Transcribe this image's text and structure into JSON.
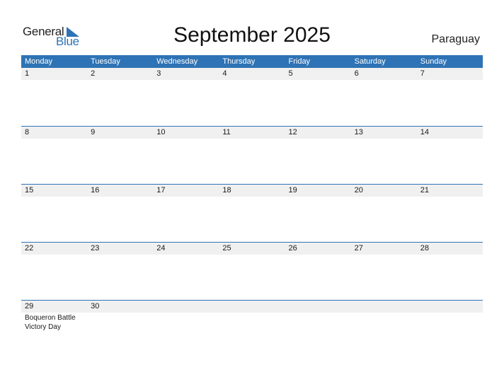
{
  "logo": {
    "word1": "General",
    "word2": "Blue"
  },
  "title": "September 2025",
  "country": "Paraguay",
  "weekdays": [
    "Monday",
    "Tuesday",
    "Wednesday",
    "Thursday",
    "Friday",
    "Saturday",
    "Sunday"
  ],
  "weeks": [
    {
      "days": [
        "1",
        "2",
        "3",
        "4",
        "5",
        "6",
        "7"
      ],
      "events": [
        "",
        "",
        "",
        "",
        "",
        "",
        ""
      ]
    },
    {
      "days": [
        "8",
        "9",
        "10",
        "11",
        "12",
        "13",
        "14"
      ],
      "events": [
        "",
        "",
        "",
        "",
        "",
        "",
        ""
      ]
    },
    {
      "days": [
        "15",
        "16",
        "17",
        "18",
        "19",
        "20",
        "21"
      ],
      "events": [
        "",
        "",
        "",
        "",
        "",
        "",
        ""
      ]
    },
    {
      "days": [
        "22",
        "23",
        "24",
        "25",
        "26",
        "27",
        "28"
      ],
      "events": [
        "",
        "",
        "",
        "",
        "",
        "",
        ""
      ]
    },
    {
      "days": [
        "29",
        "30",
        "",
        "",
        "",
        "",
        ""
      ],
      "events": [
        "Boqueron Battle Victory Day",
        "",
        "",
        "",
        "",
        "",
        ""
      ]
    }
  ],
  "colors": {
    "accent": "#2e73b5",
    "strip": "#f0f0f0"
  }
}
